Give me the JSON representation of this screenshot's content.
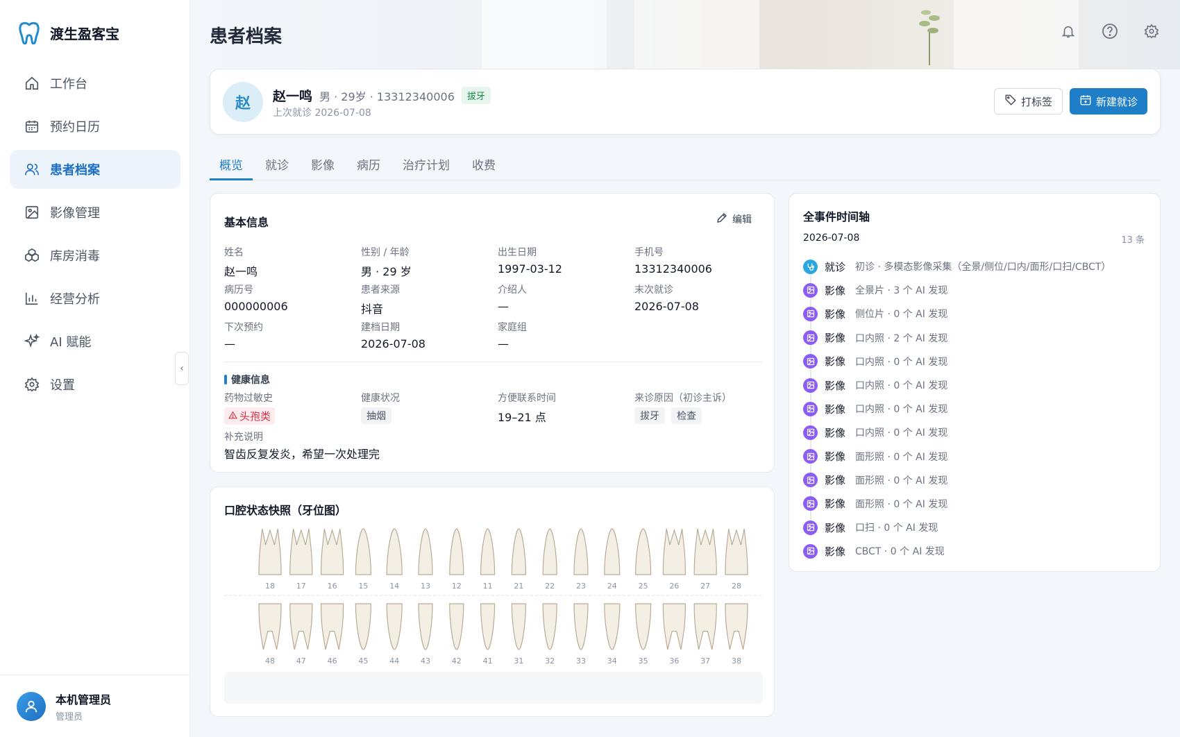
{
  "app": {
    "name": "渡生盈客宝"
  },
  "sidebar": {
    "items": [
      {
        "label": "工作台",
        "icon": "home-icon"
      },
      {
        "label": "预约日历",
        "icon": "calendar-icon"
      },
      {
        "label": "患者档案",
        "icon": "users-icon",
        "active": true
      },
      {
        "label": "影像管理",
        "icon": "image-icon"
      },
      {
        "label": "库房消毒",
        "icon": "boxes-icon"
      },
      {
        "label": "经营分析",
        "icon": "bar-chart-icon"
      },
      {
        "label": "AI 赋能",
        "icon": "sparkle-icon"
      },
      {
        "label": "设置",
        "icon": "gear-icon"
      }
    ],
    "collapse_glyph": "‹"
  },
  "user": {
    "name": "本机管理员",
    "role": "管理员"
  },
  "header": {
    "title": "患者档案"
  },
  "patient": {
    "avatar_char": "赵",
    "name": "赵一鸣",
    "meta": "男 · 29岁 · 13312340006",
    "tag": "拔牙",
    "last_visit": "上次就诊 2026-07-08",
    "tag_button": "打标签",
    "new_visit_button": "新建就诊"
  },
  "tabs": [
    "概览",
    "就诊",
    "影像",
    "病历",
    "治疗计划",
    "收费"
  ],
  "basic_info": {
    "title": "基本信息",
    "edit_label": "编辑",
    "rows": [
      [
        {
          "label": "姓名",
          "value": "赵一鸣"
        },
        {
          "label": "性别 / 年龄",
          "value": "男 · 29 岁"
        },
        {
          "label": "出生日期",
          "value": "1997-03-12"
        },
        {
          "label": "手机号",
          "value": "13312340006"
        }
      ],
      [
        {
          "label": "病历号",
          "value": "000000006"
        },
        {
          "label": "患者来源",
          "value": "抖音"
        },
        {
          "label": "介绍人",
          "value": "—"
        },
        {
          "label": "末次就诊",
          "value": "2026-07-08"
        }
      ],
      [
        {
          "label": "下次预约",
          "value": "—"
        },
        {
          "label": "建档日期",
          "value": "2026-07-08"
        },
        {
          "label": "家庭组",
          "value": "—"
        },
        {
          "label": "",
          "value": ""
        }
      ]
    ],
    "health": {
      "title": "健康信息",
      "allergy_label": "药物过敏史",
      "allergy_value": "头孢类",
      "status_label": "健康状况",
      "status_value": "抽烟",
      "contact_label": "方便联系时间",
      "contact_value": "19–21 点",
      "reason_label": "来诊原因（初诊主诉）",
      "reasons": [
        "拔牙",
        "检查"
      ],
      "note_label": "补充说明",
      "note_value": "智齿反复发炎，希望一次处理完"
    }
  },
  "teeth_chart": {
    "title": "口腔状态快照（牙位图）",
    "upper": [
      "18",
      "17",
      "16",
      "15",
      "14",
      "13",
      "12",
      "11",
      "21",
      "22",
      "23",
      "24",
      "25",
      "26",
      "27",
      "28"
    ],
    "lower": [
      "48",
      "47",
      "46",
      "45",
      "44",
      "43",
      "42",
      "41",
      "31",
      "32",
      "33",
      "34",
      "35",
      "36",
      "37",
      "38"
    ]
  },
  "timeline": {
    "title": "全事件时间轴",
    "date": "2026-07-08",
    "count": "13 条",
    "events": [
      {
        "kind": "就诊",
        "type": "visit",
        "text": "初诊 · 多模态影像采集（全景/侧位/口内/面形/口扫/CBCT）"
      },
      {
        "kind": "影像",
        "type": "image",
        "text": "全景片 · 3 个 AI 发现"
      },
      {
        "kind": "影像",
        "type": "image",
        "text": "侧位片 · 0 个 AI 发现"
      },
      {
        "kind": "影像",
        "type": "image",
        "text": "口内照 · 2 个 AI 发现"
      },
      {
        "kind": "影像",
        "type": "image",
        "text": "口内照 · 0 个 AI 发现"
      },
      {
        "kind": "影像",
        "type": "image",
        "text": "口内照 · 0 个 AI 发现"
      },
      {
        "kind": "影像",
        "type": "image",
        "text": "口内照 · 0 个 AI 发现"
      },
      {
        "kind": "影像",
        "type": "image",
        "text": "口内照 · 0 个 AI 发现"
      },
      {
        "kind": "影像",
        "type": "image",
        "text": "面形照 · 0 个 AI 发现"
      },
      {
        "kind": "影像",
        "type": "image",
        "text": "面形照 · 0 个 AI 发现"
      },
      {
        "kind": "影像",
        "type": "image",
        "text": "面形照 · 0 个 AI 发现"
      },
      {
        "kind": "影像",
        "type": "image",
        "text": "口扫 · 0 个 AI 发现"
      },
      {
        "kind": "影像",
        "type": "image",
        "text": "CBCT · 0 个 AI 发现"
      }
    ]
  },
  "colors": {
    "accent": "#1f7ec8",
    "visit": "#2aa6e0",
    "image": "#8b5cf6",
    "allergy": "#d6334a"
  }
}
